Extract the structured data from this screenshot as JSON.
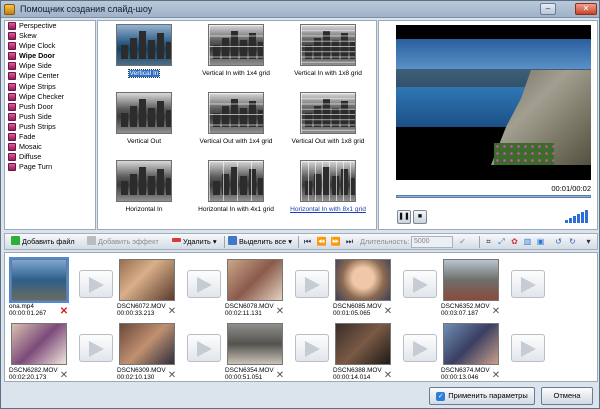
{
  "window": {
    "title": "Помощник создания слайд-шоу"
  },
  "transitions": {
    "items": [
      "Perspective",
      "Skew",
      "Wipe Clock",
      "Wipe Door",
      "Wipe Side",
      "Wipe Center",
      "Wipe Strips",
      "Wipe Checker",
      "Push Door",
      "Push Side",
      "Push Strips",
      "Fade",
      "Mosaic",
      "Diffuse",
      "Page Turn"
    ],
    "selected": "Wipe Door"
  },
  "grid": {
    "cells": [
      {
        "label": "Vertical In",
        "state": "selected"
      },
      {
        "label": "Vertical In with 1x4 grid",
        "state": ""
      },
      {
        "label": "Vertical In with 1x8 grid",
        "state": ""
      },
      {
        "label": "Vertical Out",
        "state": ""
      },
      {
        "label": "Vertical Out with 1x4 grid",
        "state": ""
      },
      {
        "label": "Vertical Out with 1x8 grid",
        "state": ""
      },
      {
        "label": "Horizontal In",
        "state": ""
      },
      {
        "label": "Horizontal In with 4x1 grid",
        "state": ""
      },
      {
        "label": "Horizontal In with 8x1 grid",
        "state": "linked"
      }
    ]
  },
  "preview": {
    "time": "00:01/00:02"
  },
  "toolbar": {
    "add_file": "Добавить файл",
    "add_effect": "Добавить эффект",
    "delete": "Удалить",
    "select_all": "Выделить все",
    "duration_label": "Длительность:",
    "duration_value": "5000"
  },
  "clips": [
    {
      "name": "ona.mp4",
      "duration": "00:00:01.267",
      "delete_style": "red",
      "palette": "mountain"
    },
    {
      "name": "DSCN6072.MOV",
      "duration": "00:00:33.213",
      "delete_style": "gray",
      "palette": "room"
    },
    {
      "name": "DSCN6078.MOV",
      "duration": "00:02:11.131",
      "delete_style": "gray",
      "palette": "room2"
    },
    {
      "name": "DSCN6085.MOV",
      "duration": "00:01:05.065",
      "delete_style": "gray",
      "palette": "face"
    },
    {
      "name": "DSCN6352.MOV",
      "duration": "00:03:07.187",
      "delete_style": "gray",
      "palette": "street"
    },
    {
      "name": "DSCN6282.MOV",
      "duration": "00:02:20.173",
      "delete_style": "gray",
      "palette": "kid"
    },
    {
      "name": "DSCN6309.MOV",
      "duration": "00:02:10.130",
      "delete_style": "gray",
      "palette": "kid2"
    },
    {
      "name": "DSCN6354.MOV",
      "duration": "00:00:51.051",
      "delete_style": "gray",
      "palette": "hall"
    },
    {
      "name": "DSCN6388.MOV",
      "duration": "00:00:14.014",
      "delete_style": "gray",
      "palette": "dark"
    },
    {
      "name": "DSCN6374.MOV",
      "duration": "00:00:13.046",
      "delete_style": "gray",
      "palette": "kid3"
    }
  ],
  "buttons": {
    "apply": "Применить параметры",
    "cancel": "Отмена"
  }
}
